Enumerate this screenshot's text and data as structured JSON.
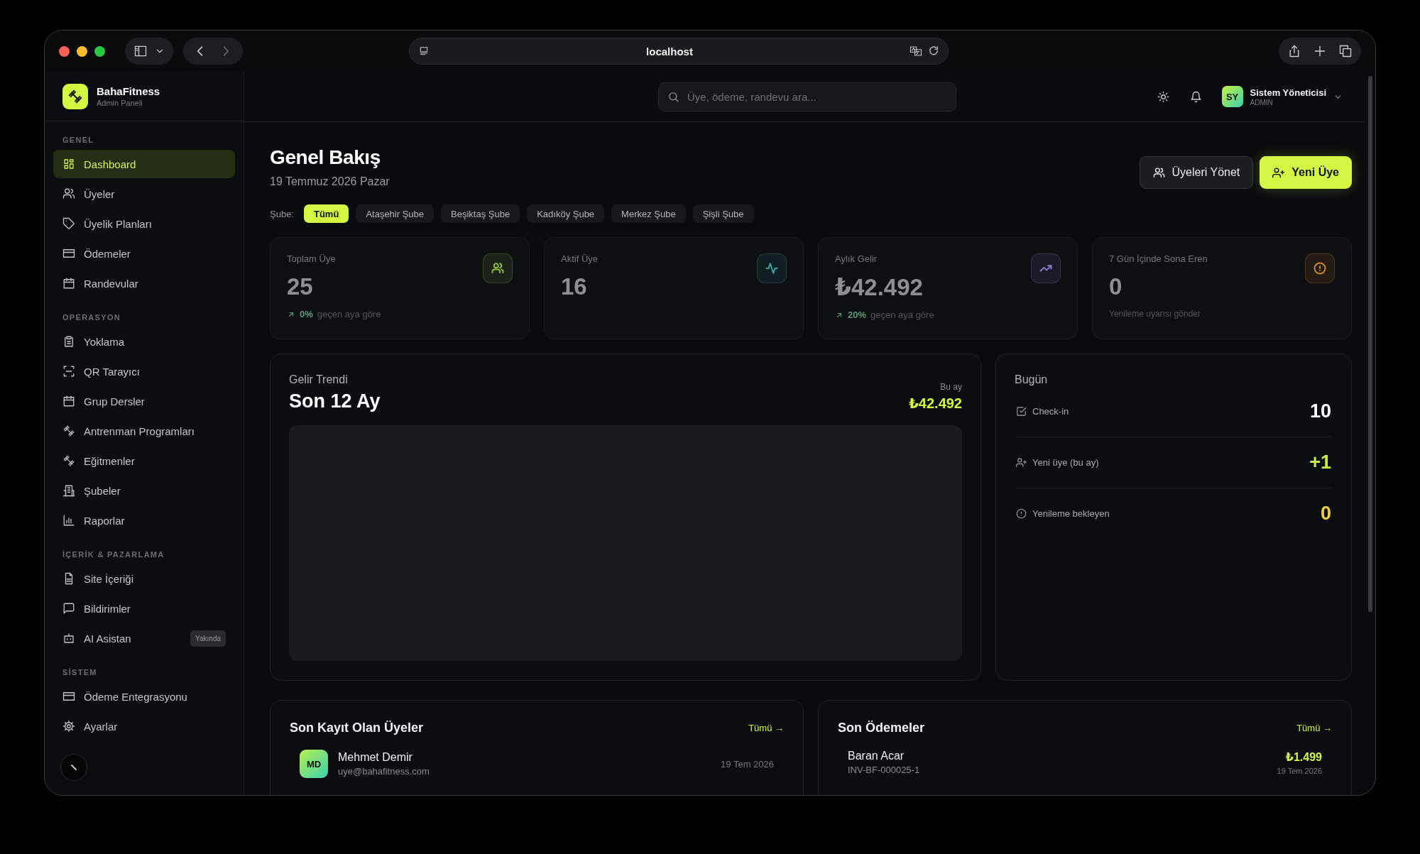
{
  "browser": {
    "url": "localhost"
  },
  "brand": {
    "name": "BahaFitness",
    "subtitle": "Admin Paneli"
  },
  "sidebar": {
    "sections": [
      {
        "title": "GENEL",
        "items": [
          {
            "label": "Dashboard",
            "selected": true
          },
          {
            "label": "Üyeler",
            "selected": false
          },
          {
            "label": "Üyelik Planları",
            "selected": false
          },
          {
            "label": "Ödemeler",
            "selected": false
          },
          {
            "label": "Randevular",
            "selected": false
          }
        ]
      },
      {
        "title": "OPERASYON",
        "items": [
          {
            "label": "Yoklama",
            "selected": false
          },
          {
            "label": "QR Tarayıcı",
            "selected": false
          },
          {
            "label": "Grup Dersler",
            "selected": false
          },
          {
            "label": "Antrenman Programları",
            "selected": false
          },
          {
            "label": "Eğitmenler",
            "selected": false
          },
          {
            "label": "Şubeler",
            "selected": false
          },
          {
            "label": "Raporlar",
            "selected": false
          }
        ]
      },
      {
        "title": "İÇERİK & PAZARLAMA",
        "items": [
          {
            "label": "Site İçeriği",
            "selected": false
          },
          {
            "label": "Bildirimler",
            "selected": false
          },
          {
            "label": "AI Asistan",
            "selected": false,
            "badge": "Yakında"
          }
        ]
      },
      {
        "title": "SİSTEM",
        "items": [
          {
            "label": "Ödeme Entegrasyonu",
            "selected": false
          },
          {
            "label": "Ayarlar",
            "selected": false
          }
        ]
      }
    ]
  },
  "header": {
    "search": {
      "placeholder": "Üye, ödeme, randevu ara..."
    },
    "user": {
      "initials": "SY",
      "name": "Sistem Yöneticisi",
      "role": "ADMIN"
    }
  },
  "page": {
    "title": "Genel Bakış",
    "date": "19 Temmuz 2026 Pazar",
    "buttons": [
      {
        "label": "Üyeleri Yönet",
        "kind": "secondary"
      },
      {
        "label": "Yeni Üye",
        "kind": "primary"
      }
    ]
  },
  "branch_filter": {
    "label": "Şube:",
    "options": [
      {
        "label": "Tümü",
        "selected": true
      },
      {
        "label": "Ataşehir Şube",
        "selected": false
      },
      {
        "label": "Beşiktaş Şube",
        "selected": false
      },
      {
        "label": "Kadıköy Şube",
        "selected": false
      },
      {
        "label": "Merkez Şube",
        "selected": false
      },
      {
        "label": "Şişli Şube",
        "selected": false
      }
    ]
  },
  "stats": [
    {
      "label": "Toplam Üye",
      "value": "25",
      "color": "#8dbb3c",
      "kind": "trend",
      "change": "0%",
      "note": "geçen aya göre"
    },
    {
      "label": "Aktif Üye",
      "value": "16",
      "color": "#3aa7a0"
    },
    {
      "label": "Aylık Gelir",
      "value": "₺42.492",
      "color": "#8a78c8",
      "kind": "trend",
      "change": "20%",
      "note": "geçen aya göre"
    },
    {
      "label": "7 Gün İçinde Sona Eren",
      "value": "0",
      "color": "#c98a2a",
      "kind": "note",
      "note": "Yenileme uyarısı gönder"
    }
  ],
  "revenue": {
    "label": "Gelir Trendi",
    "title": "Son 12 Ay",
    "period_label": "Bu ay",
    "period_value": "₺42.492"
  },
  "today": {
    "title": "Bugün",
    "rows": [
      {
        "label": "Check-in",
        "value": "10",
        "color": "#ffffff"
      },
      {
        "label": "Yeni üye (bu ay)",
        "value": "+1",
        "color": "#c8f03c"
      },
      {
        "label": "Yenileme bekleyen",
        "value": "0",
        "color": "#f2d03a"
      }
    ]
  },
  "recent_members": {
    "title": "Son Kayıt Olan Üyeler",
    "link": "Tümü →",
    "rows": [
      {
        "initials": "MD",
        "name": "Mehmet Demir",
        "email": "uye@bahafitness.com",
        "date": "19 Tem 2026"
      }
    ]
  },
  "recent_payments": {
    "title": "Son Ödemeler",
    "link": "Tümü →",
    "rows": [
      {
        "name": "Baran Acar",
        "invoice": "INV-BF-000025-1",
        "amount": "₺1.499",
        "date": "19 Tem 2026"
      }
    ]
  }
}
